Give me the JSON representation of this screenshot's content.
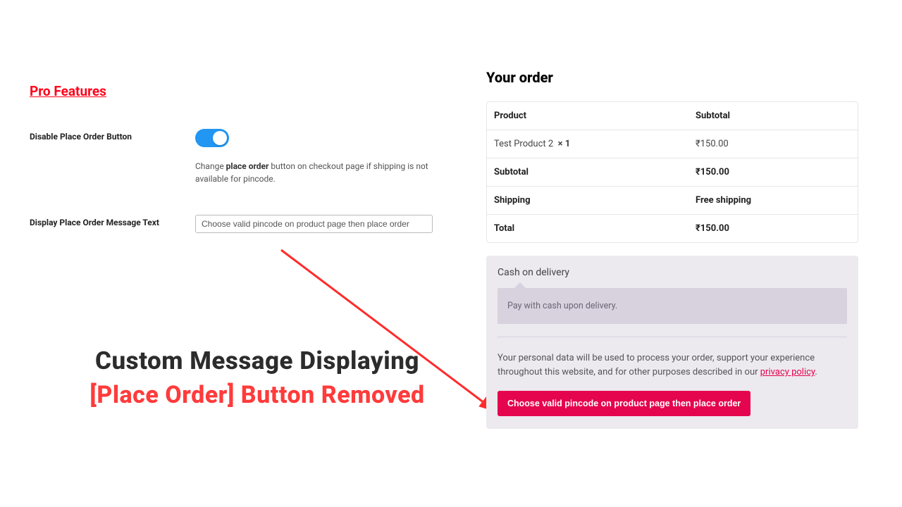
{
  "left": {
    "pro_features": "Pro Features",
    "settings": [
      {
        "label": "Disable Place Order Button",
        "toggle_on": true,
        "desc_pre": "Change",
        "desc_bold": "place order",
        "desc_post": "button on checkout page if shipping is not available for pincode."
      },
      {
        "label": "Display Place Order Message Text",
        "value": "Choose valid pincode on product page then place order"
      }
    ]
  },
  "annotation": {
    "line1": "Custom Message Displaying",
    "line2": "[Place Order] Button Removed"
  },
  "order": {
    "heading": "Your order",
    "table": {
      "header": {
        "product": "Product",
        "subtotal": "Subtotal"
      },
      "items": [
        {
          "name": "Test Product 2",
          "qty": "× 1",
          "price": "₹150.00"
        }
      ],
      "summary": {
        "subtotal_label": "Subtotal",
        "subtotal_value": "₹150.00",
        "shipping_label": "Shipping",
        "shipping_value": "Free shipping",
        "total_label": "Total",
        "total_value": "₹150.00"
      }
    },
    "payment": {
      "method": "Cash on delivery",
      "description": "Pay with cash upon delivery."
    },
    "privacy": {
      "text": "Your personal data will be used to process your order, support your experience throughout this website, and for other purposes described in our",
      "link_text": "privacy policy",
      "suffix": "."
    },
    "button_message": "Choose valid pincode on product page then place order"
  }
}
